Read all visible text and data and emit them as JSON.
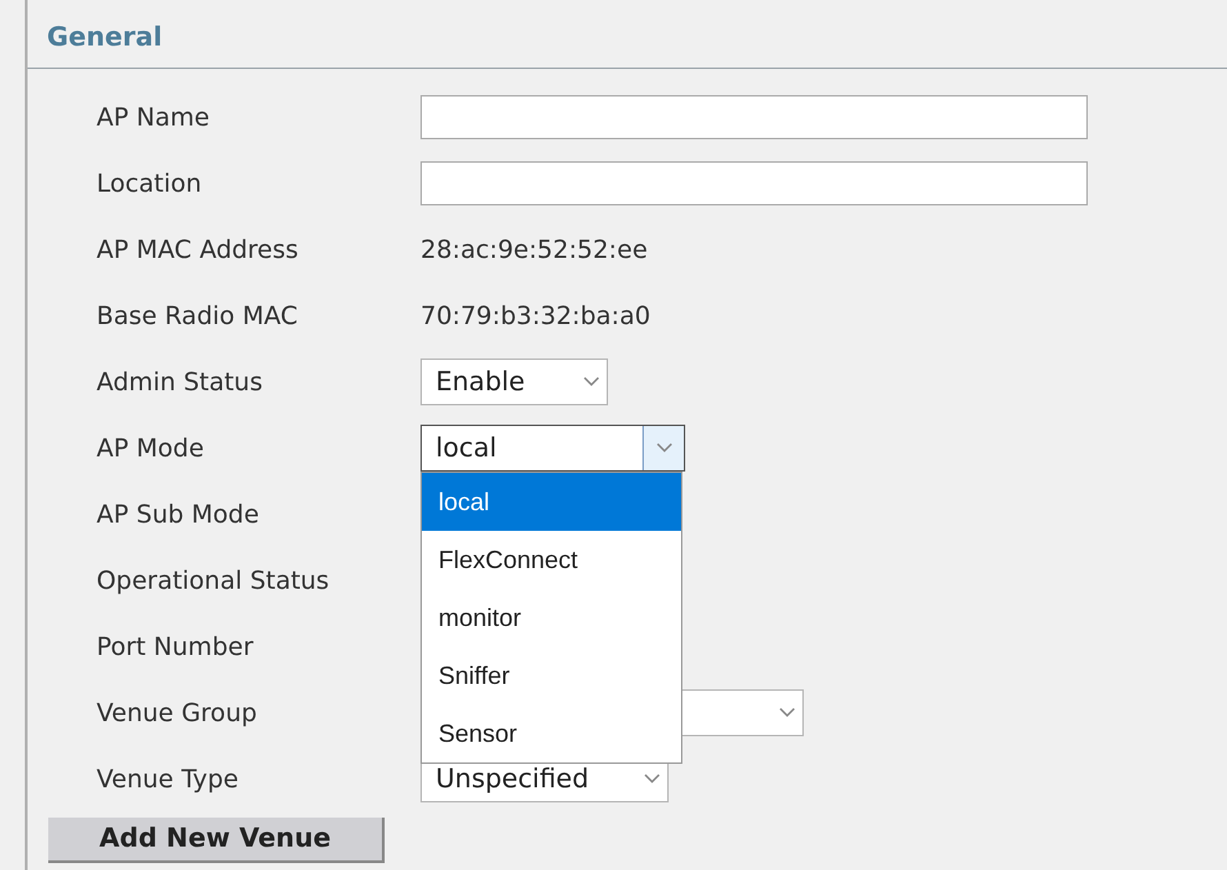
{
  "section": {
    "title": "General"
  },
  "rows": [
    {
      "label": "AP Name",
      "kind": "text_field"
    },
    {
      "label": "Location",
      "kind": "text_field"
    },
    {
      "label": "AP MAC Address",
      "kind": "text",
      "value": "28:ac:9e:52:52:ee"
    },
    {
      "label": "Base Radio MAC",
      "kind": "text",
      "value": "70:79:b3:32:ba:a0"
    },
    {
      "label": "Admin Status",
      "kind": "select",
      "value": "Enable",
      "expanded": false
    },
    {
      "label": "AP Mode",
      "kind": "select",
      "value": "local",
      "expanded": true,
      "options": [
        {
          "label": "local",
          "selected": true
        },
        {
          "label": "FlexConnect",
          "selected": false
        },
        {
          "label": "monitor",
          "selected": false
        },
        {
          "label": "Sniffer",
          "selected": false
        },
        {
          "label": "Sensor",
          "selected": false
        }
      ]
    },
    {
      "label": "AP Sub Mode",
      "kind": "label"
    },
    {
      "label": "Operational Status",
      "kind": "label"
    },
    {
      "label": "Port Number",
      "kind": "label"
    },
    {
      "label": "Venue Group",
      "kind": "select",
      "expanded": false
    },
    {
      "label": "Venue Type",
      "kind": "select",
      "value": "Unspecified",
      "expanded": false
    }
  ],
  "button": {
    "label": "Add New Venue"
  }
}
